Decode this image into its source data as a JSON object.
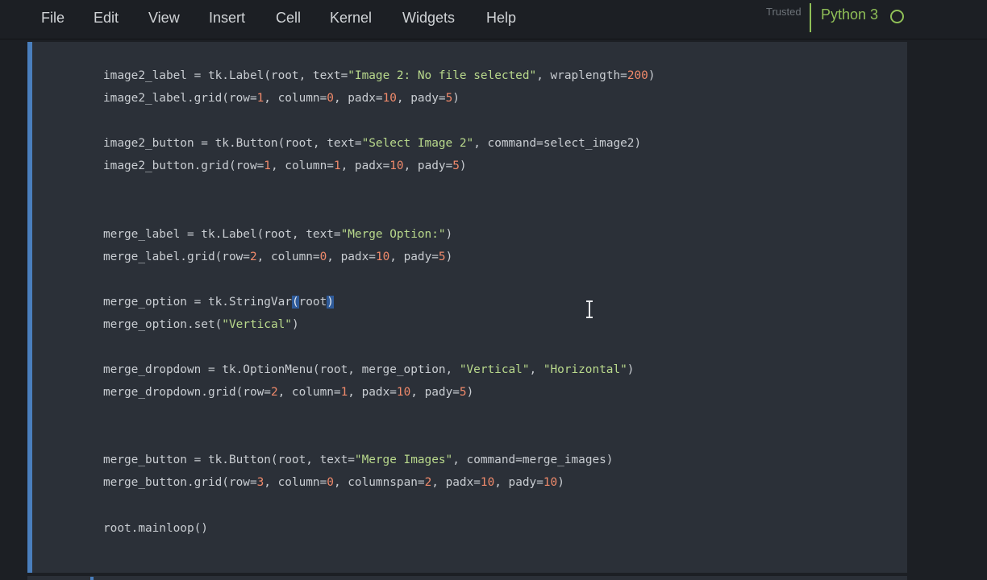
{
  "menu": {
    "items": [
      "File",
      "Edit",
      "View",
      "Insert",
      "Cell",
      "Kernel",
      "Widgets",
      "Help"
    ]
  },
  "header": {
    "trusted_label": "Trusted",
    "kernel_name": "Python 3",
    "kernel_status_icon": "kernel-idle-circle-icon"
  },
  "colors": {
    "kernel_accent": "#8fbf57",
    "cell_indicator": "#4a7fbd",
    "string": "#b9d98c",
    "number": "#f08a6b",
    "selection": "#2f5b9a"
  },
  "code": {
    "lines": [
      [
        {
          "t": "image2_label = tk.Label(root, text="
        },
        {
          "t": "\"Image 2: No file selected\"",
          "c": "str"
        },
        {
          "t": ", wraplength="
        },
        {
          "t": "200",
          "c": "num"
        },
        {
          "t": ")"
        }
      ],
      [
        {
          "t": "image2_label.grid(row="
        },
        {
          "t": "1",
          "c": "num"
        },
        {
          "t": ", column="
        },
        {
          "t": "0",
          "c": "num"
        },
        {
          "t": ", padx="
        },
        {
          "t": "10",
          "c": "num"
        },
        {
          "t": ", pady="
        },
        {
          "t": "5",
          "c": "num"
        },
        {
          "t": ")"
        }
      ],
      [],
      [
        {
          "t": "image2_button = tk.Button(root, text="
        },
        {
          "t": "\"Select Image 2\"",
          "c": "str"
        },
        {
          "t": ", command=select_image2)"
        }
      ],
      [
        {
          "t": "image2_button.grid(row="
        },
        {
          "t": "1",
          "c": "num"
        },
        {
          "t": ", column="
        },
        {
          "t": "1",
          "c": "num"
        },
        {
          "t": ", padx="
        },
        {
          "t": "10",
          "c": "num"
        },
        {
          "t": ", pady="
        },
        {
          "t": "5",
          "c": "num"
        },
        {
          "t": ")"
        }
      ],
      [],
      [],
      [
        {
          "t": "merge_label = tk.Label(root, text="
        },
        {
          "t": "\"Merge Option:\"",
          "c": "str"
        },
        {
          "t": ")"
        }
      ],
      [
        {
          "t": "merge_label.grid(row="
        },
        {
          "t": "2",
          "c": "num"
        },
        {
          "t": ", column="
        },
        {
          "t": "0",
          "c": "num"
        },
        {
          "t": ", padx="
        },
        {
          "t": "10",
          "c": "num"
        },
        {
          "t": ", pady="
        },
        {
          "t": "5",
          "c": "num"
        },
        {
          "t": ")"
        }
      ],
      [],
      [
        {
          "t": "merge_option = tk.StringVar"
        },
        {
          "t": "(",
          "c": "hl"
        },
        {
          "t": "root"
        },
        {
          "t": ")",
          "c": "hl"
        }
      ],
      [
        {
          "t": "merge_option.set("
        },
        {
          "t": "\"Vertical\"",
          "c": "str"
        },
        {
          "t": ")"
        }
      ],
      [],
      [
        {
          "t": "merge_dropdown = tk.OptionMenu(root, merge_option, "
        },
        {
          "t": "\"Vertical\"",
          "c": "str"
        },
        {
          "t": ", "
        },
        {
          "t": "\"Horizontal\"",
          "c": "str"
        },
        {
          "t": ")"
        }
      ],
      [
        {
          "t": "merge_dropdown.grid(row="
        },
        {
          "t": "2",
          "c": "num"
        },
        {
          "t": ", column="
        },
        {
          "t": "1",
          "c": "num"
        },
        {
          "t": ", padx="
        },
        {
          "t": "10",
          "c": "num"
        },
        {
          "t": ", pady="
        },
        {
          "t": "5",
          "c": "num"
        },
        {
          "t": ")"
        }
      ],
      [],
      [],
      [
        {
          "t": "merge_button = tk.Button(root, text="
        },
        {
          "t": "\"Merge Images\"",
          "c": "str"
        },
        {
          "t": ", command=merge_images)"
        }
      ],
      [
        {
          "t": "merge_button.grid(row="
        },
        {
          "t": "3",
          "c": "num"
        },
        {
          "t": ", column="
        },
        {
          "t": "0",
          "c": "num"
        },
        {
          "t": ", columnspan="
        },
        {
          "t": "2",
          "c": "num"
        },
        {
          "t": ", padx="
        },
        {
          "t": "10",
          "c": "num"
        },
        {
          "t": ", pady="
        },
        {
          "t": "10",
          "c": "num"
        },
        {
          "t": ")"
        }
      ],
      [],
      [
        {
          "t": "root.mainloop()"
        }
      ]
    ]
  }
}
